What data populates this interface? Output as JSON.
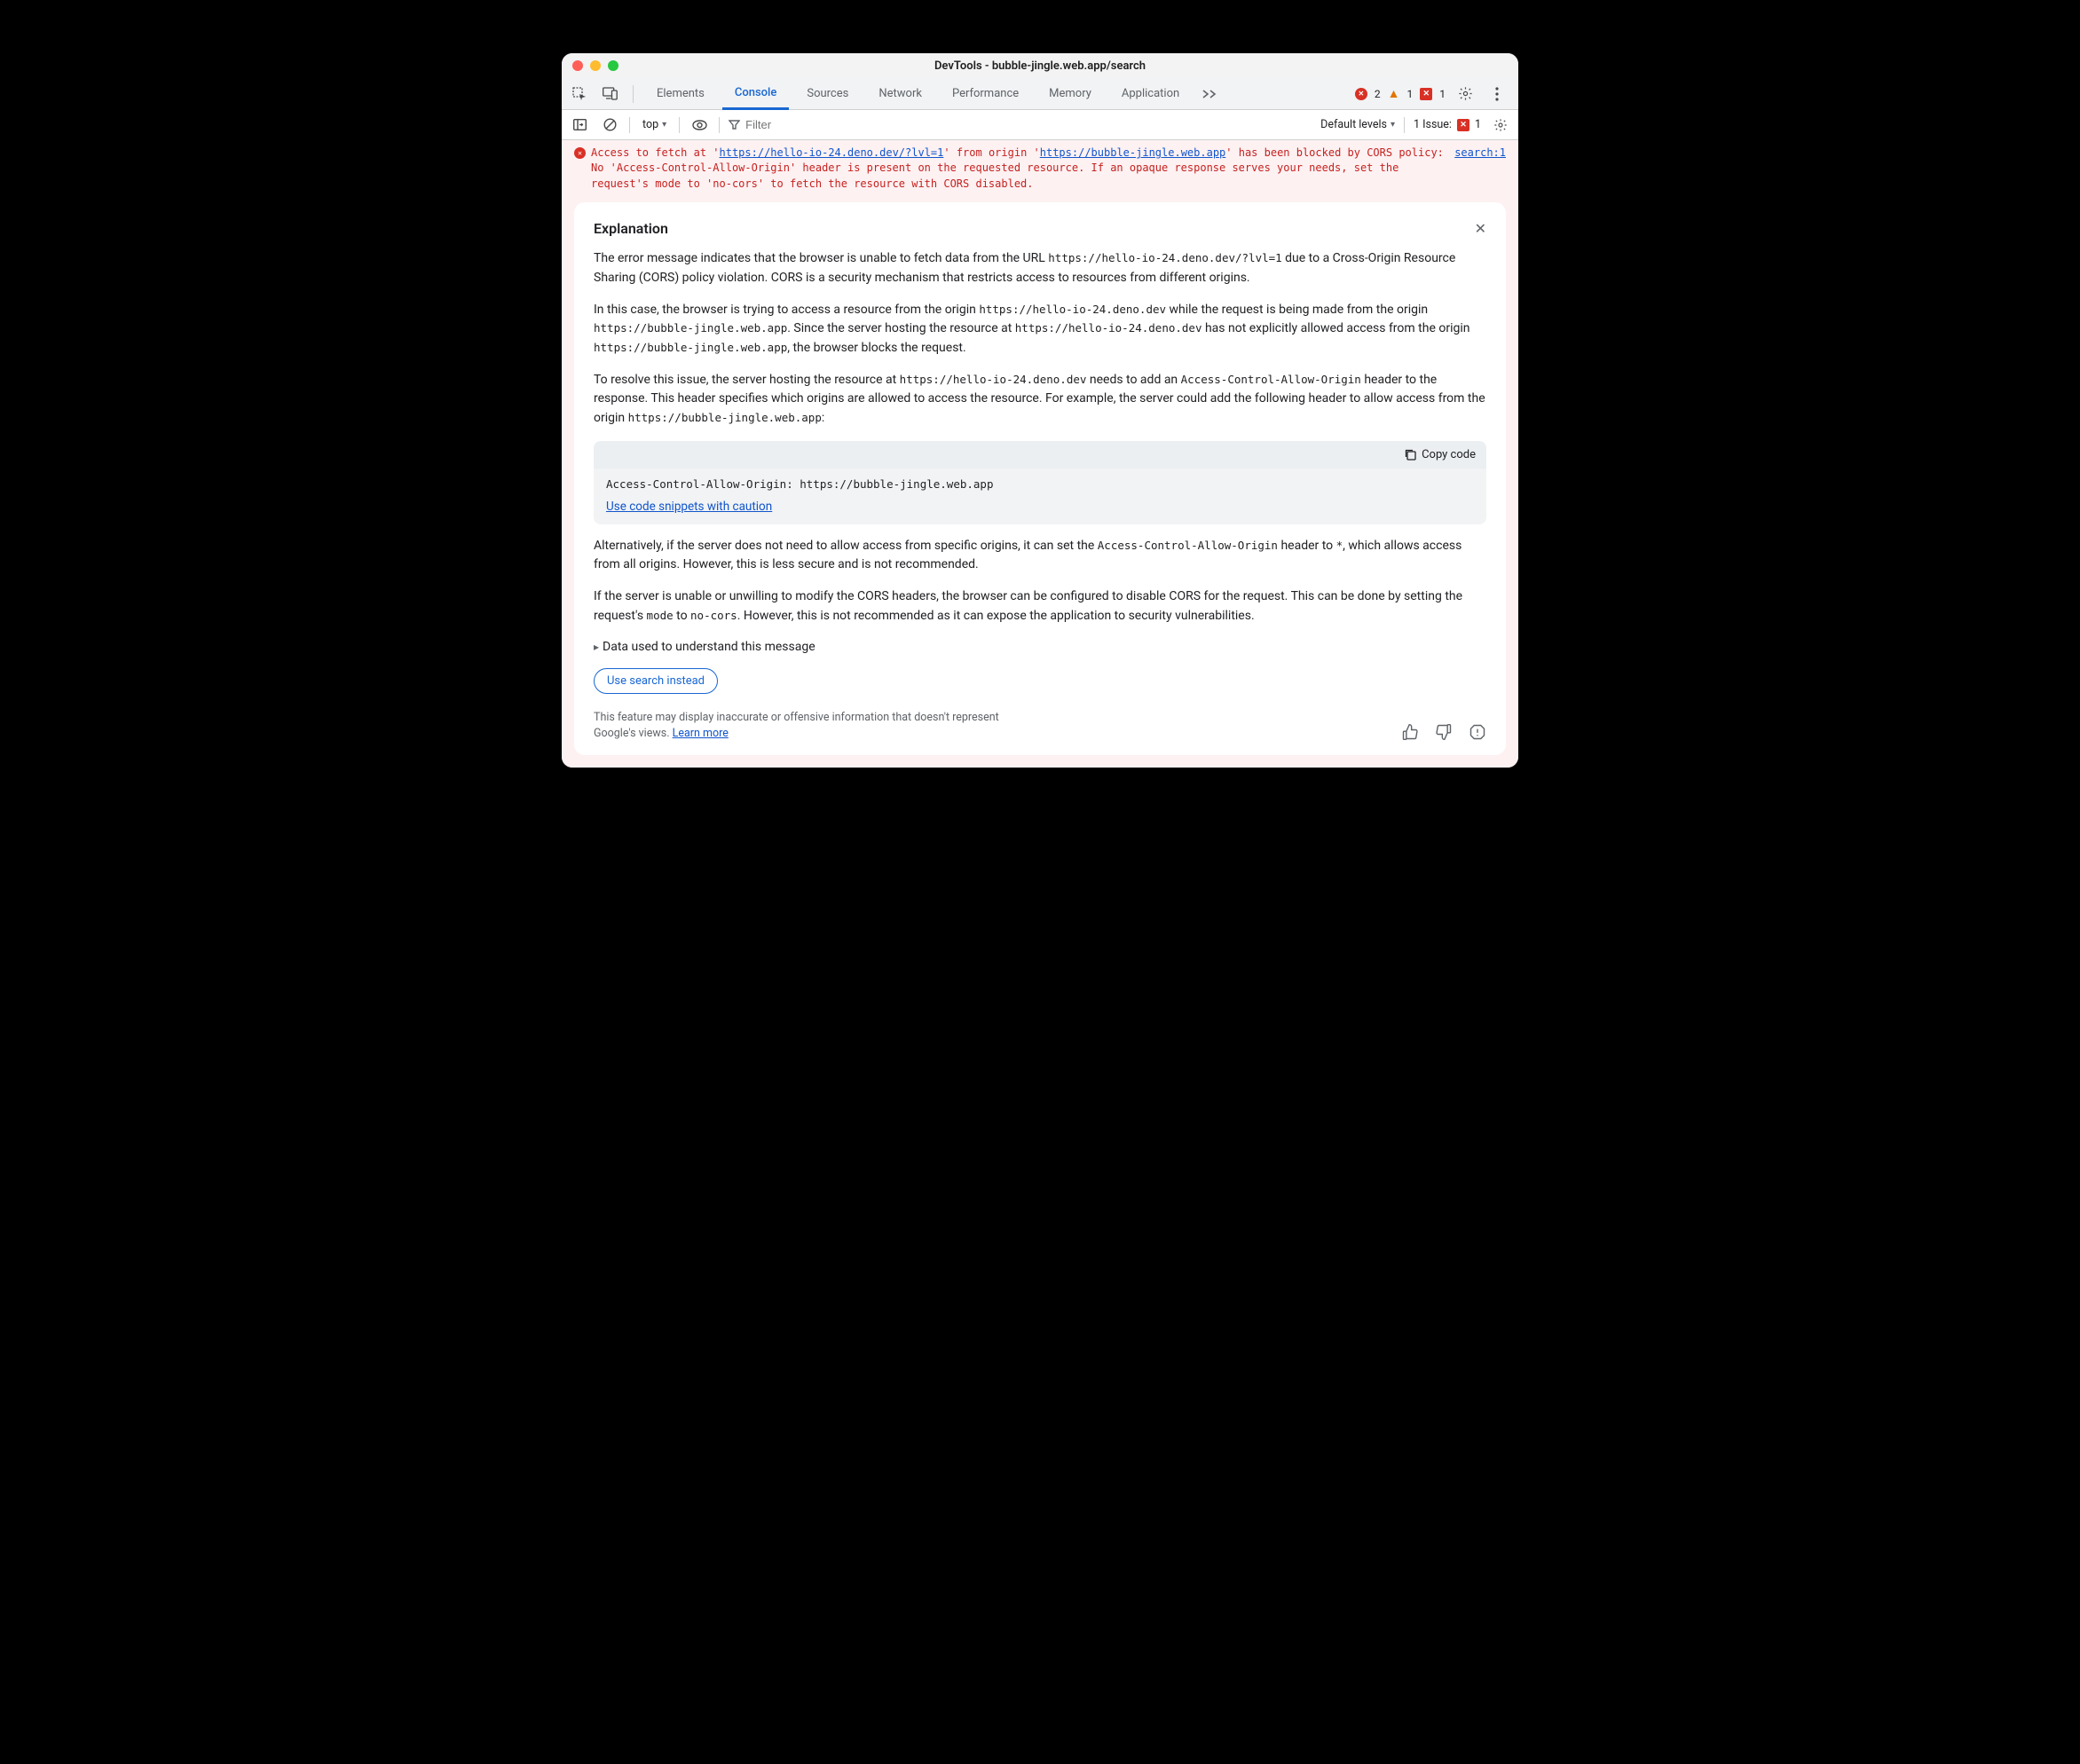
{
  "window_title": "DevTools - bubble-jingle.web.app/search",
  "tabs": [
    "Elements",
    "Console",
    "Sources",
    "Network",
    "Performance",
    "Memory",
    "Application"
  ],
  "active_tab": "Console",
  "counts": {
    "errors": "2",
    "warnings": "1",
    "issues_badge": "1"
  },
  "toolbar": {
    "context": "top",
    "filter_placeholder": "Filter",
    "levels": "Default levels",
    "issues_label": "1 Issue:",
    "issues_count": "1"
  },
  "error": {
    "pre1": "Access to fetch at '",
    "url1": "https://hello-io-24.deno.dev/?lvl=1",
    "mid1": "' from origin '",
    "url2": "https://bubble-jingle.web.app",
    "post": "' has been blocked by CORS policy: No 'Access-Control-Allow-Origin' header is present on the requested resource. If an opaque response serves your needs, set the request's mode to 'no-cors' to fetch the resource with CORS disabled.",
    "source": "search:1"
  },
  "explanation": {
    "title": "Explanation",
    "p1a": "The error message indicates that the browser is unable to fetch data from the URL ",
    "p1code": "https://hello-io-24.deno.dev/?lvl=1",
    "p1b": " due to a Cross-Origin Resource Sharing (CORS) policy violation. CORS is a security mechanism that restricts access to resources from different origins.",
    "p2a": "In this case, the browser is trying to access a resource from the origin ",
    "p2c1": "https://hello-io-24.deno.dev",
    "p2b": " while the request is being made from the origin ",
    "p2c2": "https://bubble-jingle.web.app",
    "p2c": ". Since the server hosting the resource at ",
    "p2c3": "https://hello-io-24.deno.dev",
    "p2d": " has not explicitly allowed access from the origin ",
    "p2c4": "https://bubble-jingle.web.app",
    "p2e": ", the browser blocks the request.",
    "p3a": "To resolve this issue, the server hosting the resource at ",
    "p3c1": "https://hello-io-24.deno.dev",
    "p3b": " needs to add an ",
    "p3c2": "Access-Control-Allow-Origin",
    "p3c": " header to the response. This header specifies which origins are allowed to access the resource. For example, the server could add the following header to allow access from the origin ",
    "p3c3": "https://bubble-jingle.web.app",
    "p3d": ":",
    "copy_label": "Copy code",
    "code": "Access-Control-Allow-Origin: https://bubble-jingle.web.app",
    "caution": "Use code snippets with caution",
    "p4a": "Alternatively, if the server does not need to allow access from specific origins, it can set the ",
    "p4c1": "Access-Control-Allow-Origin",
    "p4b": " header to ",
    "p4c2": "*",
    "p4c": ", which allows access from all origins. However, this is less secure and is not recommended.",
    "p5a": "If the server is unable or unwilling to modify the CORS headers, the browser can be configured to disable CORS for the request. This can be done by setting the request's ",
    "p5c1": "mode",
    "p5b": " to ",
    "p5c2": "no-cors",
    "p5c": ". However, this is not recommended as it can expose the application to security vulnerabilities.",
    "details": "Data used to understand this message",
    "search_btn": "Use search instead",
    "footer_a": "This feature may display inaccurate or offensive information that doesn't represent Google's views. ",
    "footer_link": "Learn more"
  }
}
